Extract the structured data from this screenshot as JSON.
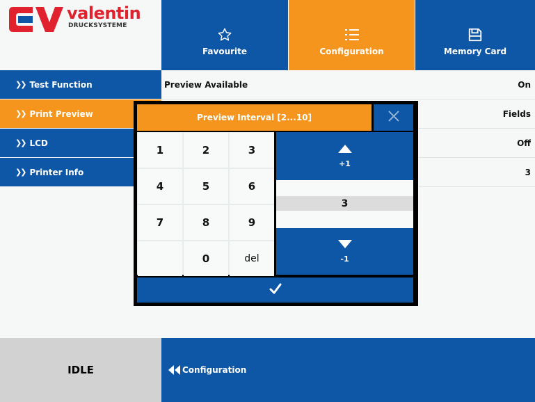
{
  "brand": {
    "name": "valentin",
    "subtitle": "DRUCKSYSTEME",
    "logo_colors": [
      "#e0222e",
      "#0e56a6"
    ]
  },
  "header": {
    "buttons": [
      {
        "label": "Favourite",
        "icon": "star-icon"
      },
      {
        "label": "Configuration",
        "icon": "list-icon",
        "active": true
      },
      {
        "label": "Memory Card",
        "icon": "floppy-disk-icon"
      }
    ]
  },
  "sidebar": {
    "items": [
      {
        "label": "Test Function"
      },
      {
        "label": "Print Preview",
        "active": true
      },
      {
        "label": "LCD"
      },
      {
        "label": "Printer Info"
      }
    ]
  },
  "settings": {
    "rows": [
      {
        "label": "Preview Available",
        "value": "On"
      },
      {
        "label": "",
        "value": "Fields"
      },
      {
        "label": "",
        "value": "Off"
      },
      {
        "label": "",
        "value": "3"
      }
    ]
  },
  "dialog": {
    "title": "Preview Interval [2...10]",
    "keys": [
      "1",
      "2",
      "3",
      "4",
      "5",
      "6",
      "7",
      "8",
      "9",
      "",
      "0",
      "del"
    ],
    "increment_label": "+1",
    "decrement_label": "-1",
    "value": "3"
  },
  "footer": {
    "status": "IDLE",
    "back_label": "Configuration"
  },
  "colors": {
    "primary": "#0e56a6",
    "accent": "#f5951d",
    "status_bg": "#d2d2d2",
    "background": "#f5f8f7"
  }
}
